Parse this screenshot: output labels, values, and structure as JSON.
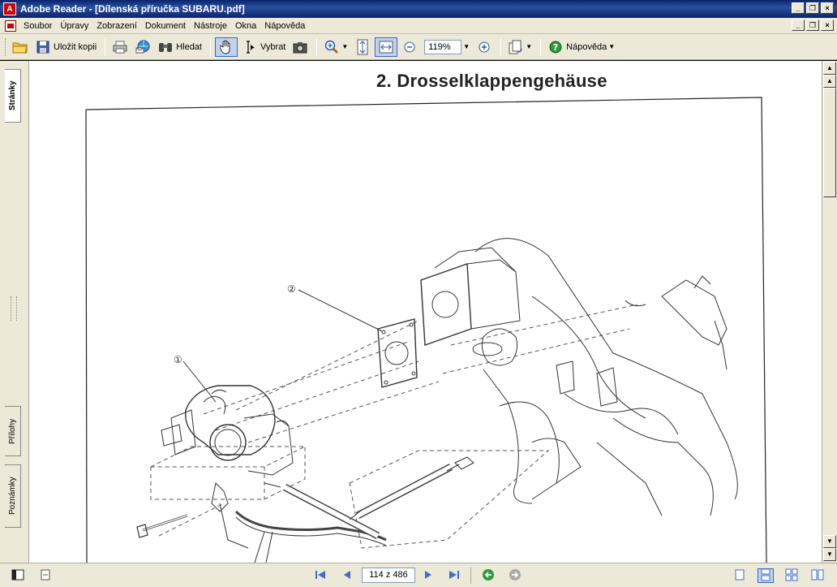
{
  "window": {
    "title": "Adobe Reader - [Dílenská příručka SUBARU.pdf]",
    "icon_letter": "A",
    "controls": [
      "_",
      "❐",
      "×"
    ]
  },
  "menu": {
    "items": [
      "Soubor",
      "Úpravy",
      "Zobrazení",
      "Dokument",
      "Nástroje",
      "Okna",
      "Nápověda"
    ]
  },
  "toolbar": {
    "save_copy_label": "Uložit kopii",
    "find_label": "Hledat",
    "select_label": "Vybrat",
    "zoom_value": "119%",
    "help_label": "Nápověda"
  },
  "nav_tabs": {
    "pages": "Stránky",
    "attachments": "Přílohy",
    "comments": "Poznámky"
  },
  "document": {
    "heading": "2.  Drosselklappengehäuse",
    "callout_1": "①",
    "callout_2": "②"
  },
  "status": {
    "page_indicator": "114 z 486"
  },
  "colors": {
    "titlebar": "#0a246a",
    "chrome": "#ece9d8",
    "accent": "#316ac5"
  }
}
